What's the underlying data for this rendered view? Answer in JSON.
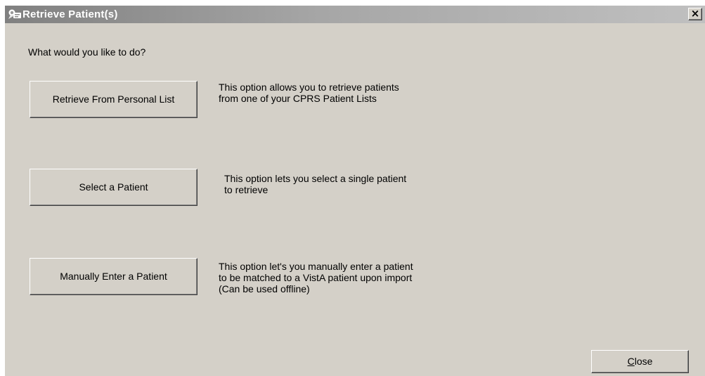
{
  "window": {
    "title": "Retrieve Patient(s)",
    "close_glyph": "×"
  },
  "prompt": "What would you like to do?",
  "options": [
    {
      "button_label": "Retrieve From Personal List",
      "description": "This option allows you to retrieve patients\nfrom one of your CPRS Patient Lists"
    },
    {
      "button_label": "Select a Patient",
      "description": "This option lets you select a single patient\nto retrieve"
    },
    {
      "button_label": "Manually Enter a Patient",
      "description": "This option let's you manually enter a patient\nto be matched to a VistA patient upon import\n(Can be used offline)"
    }
  ],
  "footer": {
    "close_mnemonic": "C",
    "close_rest": "lose"
  },
  "icons": {
    "title_icon": "patient-retrieve-icon"
  },
  "colors": {
    "dialog_face": "#d4d0c8",
    "titlebar_inactive": "#808080"
  }
}
